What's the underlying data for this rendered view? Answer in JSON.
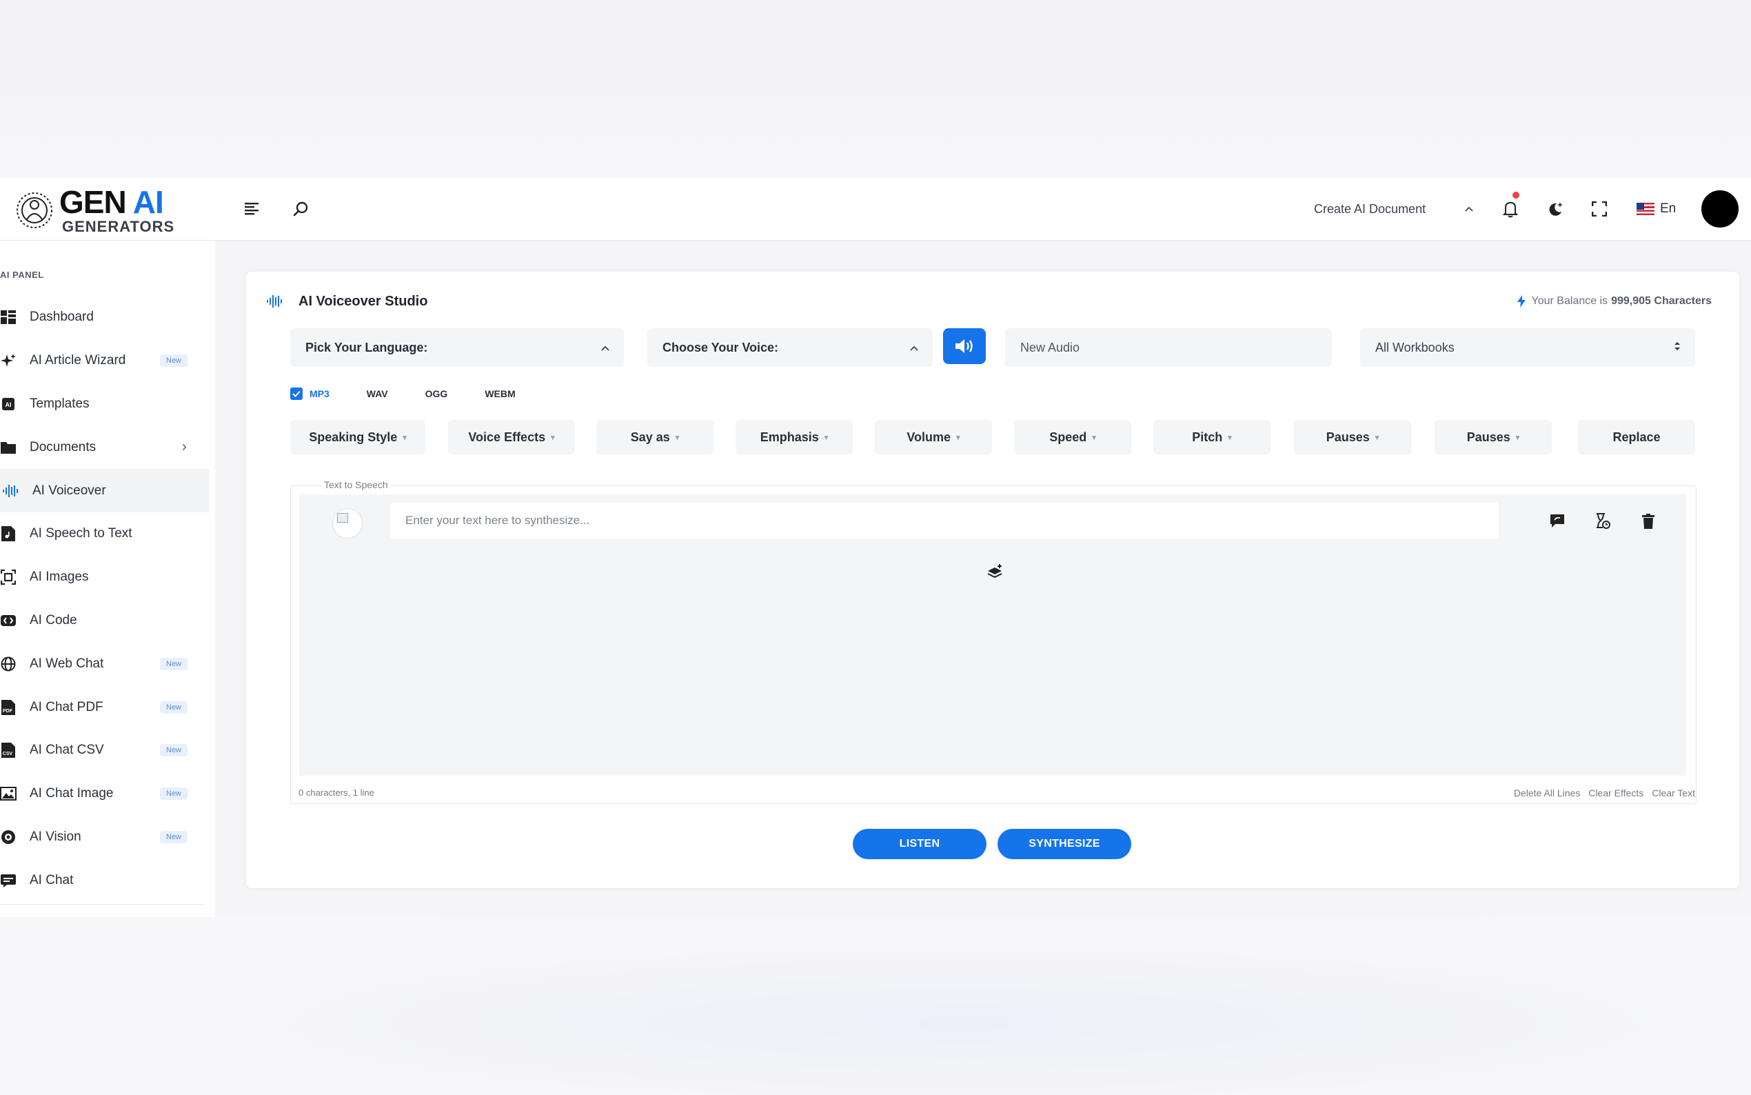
{
  "brand": {
    "line1a": "GEN",
    "line1b": "AI",
    "line2": "GENERATORS"
  },
  "header": {
    "create_doc": "Create AI Document",
    "language": "En",
    "icons": [
      "menu-icon",
      "search-icon",
      "chevron-up-icon",
      "bell-icon",
      "moon-icon",
      "fullscreen-icon"
    ]
  },
  "sidebar": {
    "section": "AI PANEL",
    "items": [
      {
        "label": "Dashboard",
        "icon": "dashboard-icon",
        "badge": ""
      },
      {
        "label": "AI Article Wizard",
        "icon": "sparkle-icon",
        "badge": "New"
      },
      {
        "label": "Templates",
        "icon": "templates-icon",
        "badge": ""
      },
      {
        "label": "Documents",
        "icon": "folder-icon",
        "badge": ""
      },
      {
        "label": "AI Voiceover",
        "icon": "waveform-icon",
        "badge": ""
      },
      {
        "label": "AI Speech to Text",
        "icon": "music-file-icon",
        "badge": ""
      },
      {
        "label": "AI Images",
        "icon": "image-scan-icon",
        "badge": ""
      },
      {
        "label": "AI Code",
        "icon": "code-icon",
        "badge": ""
      },
      {
        "label": "AI Web Chat",
        "icon": "globe-icon",
        "badge": "New"
      },
      {
        "label": "AI Chat PDF",
        "icon": "pdf-icon",
        "badge": "New"
      },
      {
        "label": "AI Chat CSV",
        "icon": "csv-icon",
        "badge": "New"
      },
      {
        "label": "AI Chat Image",
        "icon": "picture-icon",
        "badge": "New"
      },
      {
        "label": "AI Vision",
        "icon": "vision-icon",
        "badge": "New"
      },
      {
        "label": "AI Chat",
        "icon": "chat-icon",
        "badge": ""
      }
    ]
  },
  "studio": {
    "title": "AI Voiceover Studio",
    "balance_prefix": "Your Balance is",
    "balance_value": "999,905 Characters",
    "language_label": "Pick Your Language:",
    "voice_label": "Choose Your Voice:",
    "audio_name": "New Audio",
    "workbook": "All Workbooks",
    "formats": [
      {
        "label": "MP3",
        "checked": true
      },
      {
        "label": "WAV",
        "checked": false
      },
      {
        "label": "OGG",
        "checked": false
      },
      {
        "label": "WEBM",
        "checked": false
      }
    ],
    "options": [
      "Speaking Style",
      "Voice Effects",
      "Say as",
      "Emphasis",
      "Volume",
      "Speed",
      "Pitch",
      "Pauses",
      "Pauses",
      "Replace"
    ],
    "tts_legend": "Text to Speech",
    "text_placeholder": "Enter your text here to synthesize...",
    "counter": "0 characters, 1 line",
    "links": [
      "Delete All Lines",
      "Clear Effects",
      "Clear Text"
    ],
    "listen": "LISTEN",
    "synthesize": "SYNTHESIZE"
  },
  "colors": {
    "accent": "#1674ea",
    "notification": "#ef3e4a"
  }
}
